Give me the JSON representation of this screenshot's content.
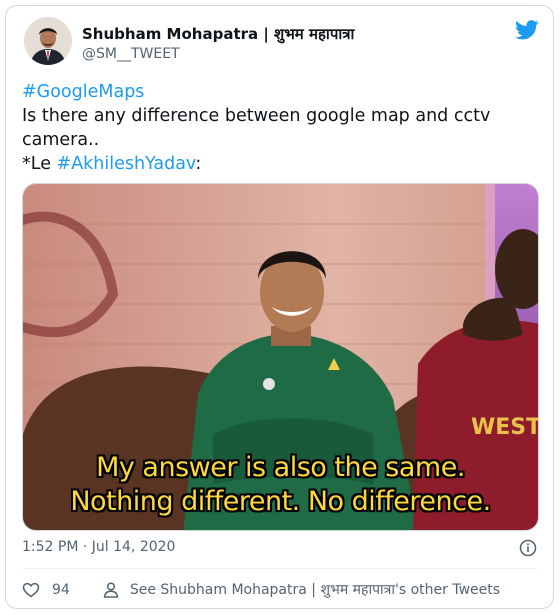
{
  "tweet": {
    "author_name": "Shubham Mohapatra | शुभम महापात्रा",
    "handle": "@SM__TWEET",
    "text_parts": {
      "hashtag1": "#GoogleMaps",
      "line1": "Is there any difference between google map and cctv camera..",
      "prefix": "*Le ",
      "hashtag2": "#AkhileshYadav",
      "suffix": ":"
    },
    "media": {
      "caption_line1": "My answer is also the same.",
      "caption_line2": "Nothing different. No difference.",
      "jersey_text": "WEST I"
    },
    "timestamp": "1:52 PM · Jul 14, 2020",
    "like_count": "94",
    "other_tweets_label": "See Shubham Mohapatra | शुभम महापात्रा's other Tweets"
  },
  "colors": {
    "link": "#1d9bf0",
    "caption": "#ffd93b",
    "muted": "#536471"
  },
  "icons": [
    "avatar",
    "twitter-bird-icon",
    "info-icon",
    "heart-icon",
    "person-icon"
  ]
}
